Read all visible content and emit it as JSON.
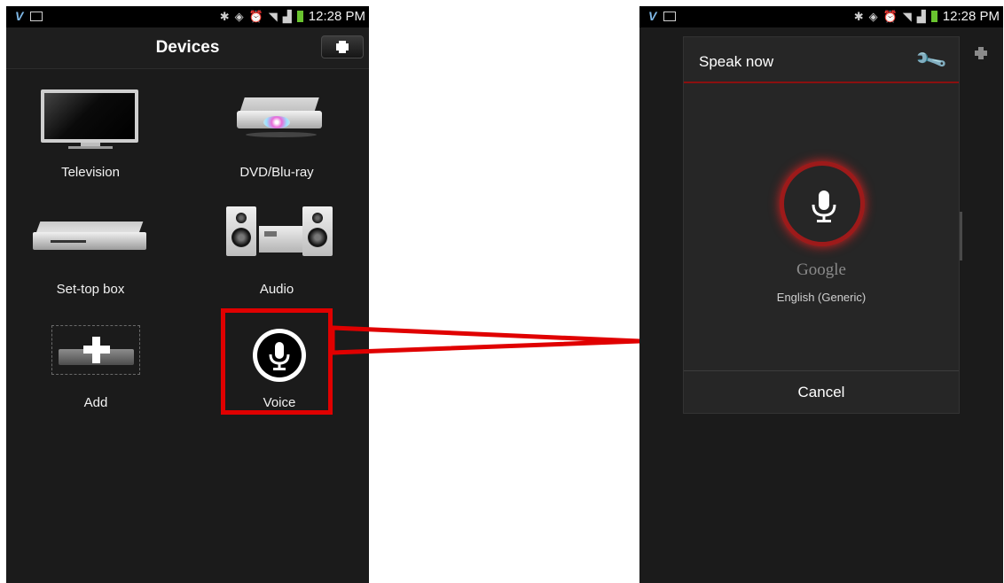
{
  "left_screen": {
    "status_bar": {
      "time": "12:28 PM"
    },
    "header": {
      "title": "Devices"
    },
    "devices": [
      {
        "label": "Television",
        "icon": "television-icon"
      },
      {
        "label": "DVD/Blu-ray",
        "icon": "dvd-player-icon"
      },
      {
        "label": "Set-top box",
        "icon": "set-top-box-icon"
      },
      {
        "label": "Audio",
        "icon": "audio-system-icon"
      },
      {
        "label": "Add",
        "icon": "add-device-icon"
      },
      {
        "label": "Voice",
        "icon": "microphone-icon"
      }
    ]
  },
  "right_screen": {
    "status_bar": {
      "time": "12:28 PM"
    },
    "dialog": {
      "title": "Speak now",
      "brand": "Google",
      "language": "English (Generic)",
      "cancel_label": "Cancel"
    }
  },
  "colors": {
    "highlight": "#e00000",
    "mic_ring": "#9d1a1a",
    "background": "#1b1b1b"
  }
}
